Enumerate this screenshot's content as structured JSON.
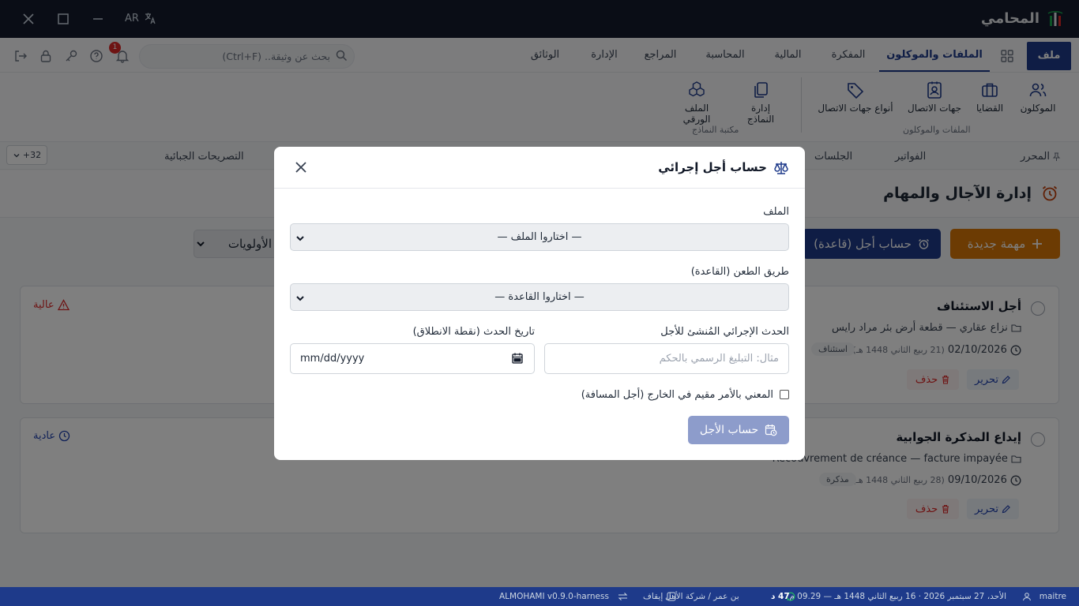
{
  "window": {
    "app_name": "المحامي",
    "lang_label": "AR"
  },
  "menu": {
    "file": "ملف",
    "tabs": [
      "الملفات والموكلون",
      "المفكرة",
      "المالية",
      "المحاسبة",
      "المراجع",
      "الإدارة",
      "الوثائق"
    ],
    "search_placeholder": "بحث عن وثيقة.. (Ctrl+F)",
    "notifications_count": "1"
  },
  "ribbon": {
    "items": [
      "الموكلون",
      "القضايا",
      "جهات الاتصال",
      "أنواع جهات الاتصال",
      "إدارة النماذج",
      "الملف الورقي"
    ],
    "group1": "الملفات والموكلون",
    "group2": "مكتبة النماذج"
  },
  "subtabs": {
    "items": [
      "المحرر",
      "الفواتير",
      "الجلسات",
      "التصريحات الجبائية"
    ],
    "more": "+32"
  },
  "page": {
    "title": "إدارة الآجال والمهام",
    "new_task": "مهمة جديدة",
    "compute_rule": "حساب أجل (قاعدة)",
    "priority_filter": "الأولويات"
  },
  "tasks": [
    {
      "title": "أجل الاستئناف",
      "file": "نزاع عقاري — قطعة أرض بئر مراد رايس",
      "date": "02/10/2026",
      "hijri": "(21 ربيع الثاني 1448 هـ)",
      "tag": "استئناف",
      "priority": "عالية",
      "edit": "تحرير",
      "delete": "حذف"
    },
    {
      "title": "إيداع المذكرة الجوابية",
      "file": "Recouvrement de créance — facture impayée",
      "date": "09/10/2026",
      "hijri": "(28 ربيع الثاني 1448 هـ)",
      "tag": "مذكرة",
      "priority": "عادية",
      "edit": "تحرير",
      "delete": "حذف"
    }
  ],
  "modal": {
    "title": "حساب أجل إجرائي",
    "file_label": "الملف",
    "file_value": "— اختاروا الملف —",
    "rule_label": "طريق الطعن (القاعدة)",
    "rule_value": "— اختاروا القاعدة —",
    "event_label": "الحدث الإجرائي المُنشئ للأجل",
    "event_placeholder": "مثال: التبليغ الرسمي بالحكم",
    "date_label": "تاريخ الحدث (نقطة الانطلاق)",
    "date_placeholder": "mm/dd/yyyy",
    "abroad_label": "المعني بالأمر مقيم في الخارج (أجل المسافة)",
    "submit": "حساب الأجل"
  },
  "status": {
    "user": "maitre",
    "date": "الأحد، 27 سبتمبر 2026 · 16 ربيع الثاني 1448 هـ — 09.29 م",
    "client": "47 د",
    "office": "بن عمر / شركة الأمل",
    "pause": "إيقاف",
    "version": "ALMOHAMI v0.9.0-harness"
  },
  "colors": {
    "primary": "#1e3a8a",
    "accent": "#d97706",
    "danger": "#dc2626",
    "titlebar": "#141b2d"
  }
}
